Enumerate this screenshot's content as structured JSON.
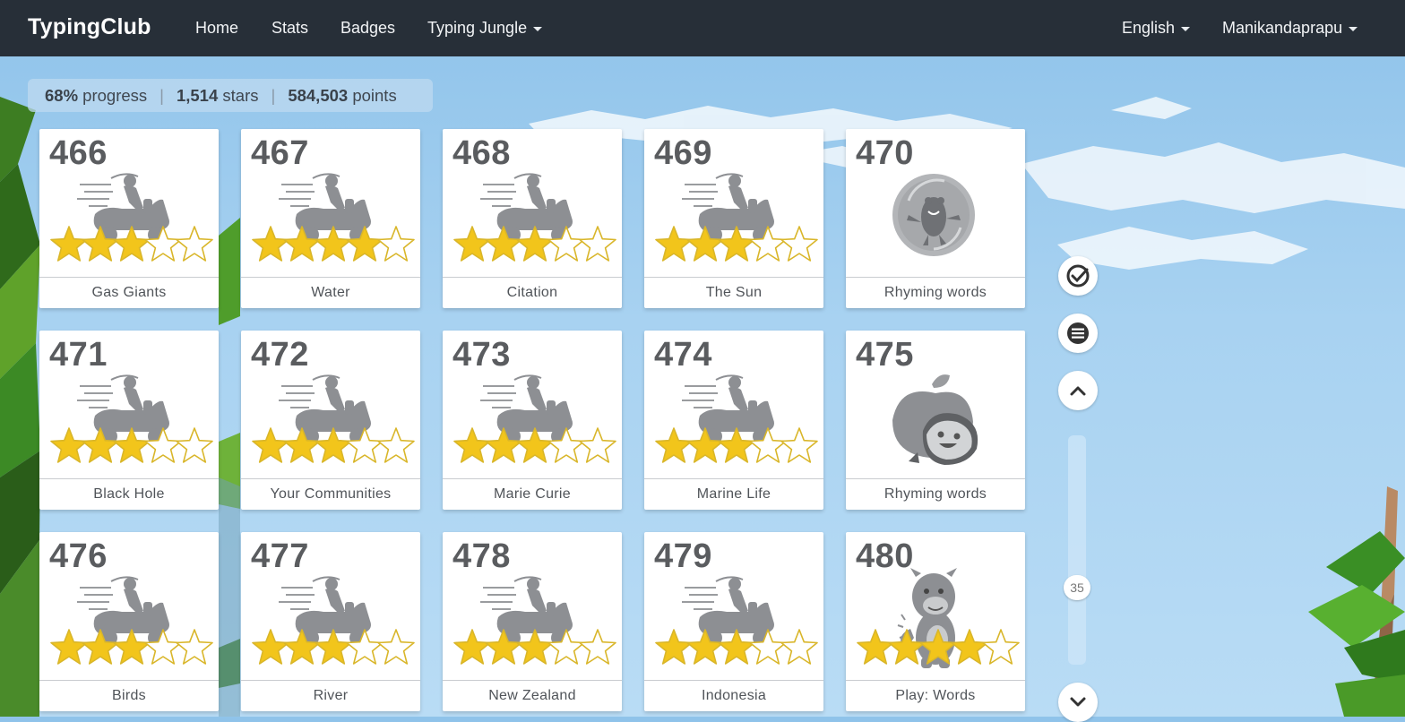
{
  "nav": {
    "brand": "TypingClub",
    "links": [
      "Home",
      "Stats",
      "Badges",
      "Typing Jungle"
    ],
    "language": "English",
    "user": "Manikandaprapu"
  },
  "summary": {
    "progress": "68%",
    "progress_label": "progress",
    "stars": "1,514",
    "stars_label": "stars",
    "points": "584,503",
    "points_label": "points"
  },
  "lessons": [
    {
      "num": "466",
      "title": "Gas Giants",
      "icon": "scooter-rider-icon",
      "stars": 3
    },
    {
      "num": "467",
      "title": "Water",
      "icon": "scooter-rider-icon",
      "stars": 4
    },
    {
      "num": "468",
      "title": "Citation",
      "icon": "scooter-rider-icon",
      "stars": 3
    },
    {
      "num": "469",
      "title": "The Sun",
      "icon": "scooter-rider-icon",
      "stars": 3
    },
    {
      "num": "470",
      "title": "Rhyming words",
      "icon": "creature-ball-icon",
      "stars": 0
    },
    {
      "num": "471",
      "title": "Black Hole",
      "icon": "scooter-rider-icon",
      "stars": 3
    },
    {
      "num": "472",
      "title": "Your Communities",
      "icon": "scooter-rider-icon",
      "stars": 3
    },
    {
      "num": "473",
      "title": "Marie Curie",
      "icon": "scooter-rider-icon",
      "stars": 3
    },
    {
      "num": "474",
      "title": "Marine Life",
      "icon": "scooter-rider-icon",
      "stars": 3
    },
    {
      "num": "475",
      "title": "Rhyming words",
      "icon": "apple-creature-icon",
      "stars": 0
    },
    {
      "num": "476",
      "title": "Birds",
      "icon": "scooter-rider-icon",
      "stars": 3
    },
    {
      "num": "477",
      "title": "River",
      "icon": "scooter-rider-icon",
      "stars": 3
    },
    {
      "num": "478",
      "title": "New Zealand",
      "icon": "scooter-rider-icon",
      "stars": 3
    },
    {
      "num": "479",
      "title": "Indonesia",
      "icon": "scooter-rider-icon",
      "stars": 3
    },
    {
      "num": "480",
      "title": "Play: Words",
      "icon": "monster-game-icon",
      "stars": 4
    }
  ],
  "star_slots": 5,
  "scroll": {
    "position": "35"
  },
  "colors": {
    "nav_bg": "#272f38",
    "sky": "#a8d2f1",
    "star_fill": "#f2c51b",
    "star_outline": "#d9b62a"
  }
}
